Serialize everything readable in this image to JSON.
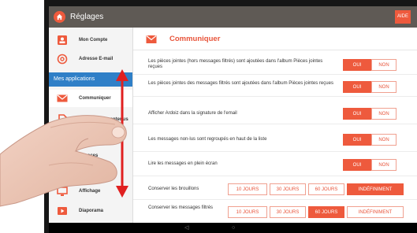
{
  "topbar": {
    "title": "Réglages",
    "aide_label": "AIDE"
  },
  "sidebar": {
    "items_top": [
      {
        "label": "Mon Compte",
        "icon": "account-icon"
      },
      {
        "label": "Adresse E-mail",
        "icon": "at-sign-icon"
      }
    ],
    "section_label": "Mes applications",
    "items_apps": [
      {
        "label": "Communiquer",
        "icon": "envelope-icon"
      },
      {
        "label": "Gestion des contenus",
        "icon": "document-icon"
      },
      {
        "label": "Espaces",
        "icon": "spaces-icon"
      },
      {
        "label": "Affichage",
        "icon": "display-icon"
      },
      {
        "label": "Diaporama",
        "icon": "slideshow-icon"
      }
    ]
  },
  "main": {
    "title": "Communiquer",
    "rows": [
      {
        "label": "Les pièces jointes (hors messages filtrés) sont ajoutées dans l'album Pièces jointes reçues",
        "on": "OUI",
        "off": "NON"
      },
      {
        "label": "Les pièces jointes des messages filtrés sont ajoutées dans l'album Pièces jointes reçues",
        "on": "OUI",
        "off": "NON"
      },
      {
        "label": "Afficher Ardoiz dans la signature de l'email",
        "on": "OUI",
        "off": "NON"
      },
      {
        "label": "Les messages non-lus sont regroupés en haut de la liste",
        "on": "OUI",
        "off": "NON"
      },
      {
        "label": "Lire les messages en plein écran",
        "on": "OUI",
        "off": "NON"
      }
    ],
    "keep_drafts": {
      "label": "Conserver les brouillons",
      "options": [
        "10 JOURS",
        "30 JOURS",
        "60 JOURS",
        "INDÉFINIMENT"
      ],
      "selected": "INDÉFINIMENT"
    },
    "keep_filtered": {
      "label": "Conserver les messages filtrés",
      "options": [
        "10 JOURS",
        "30 JOURS",
        "60 JOURS",
        "INDÉFINIMENT"
      ],
      "selected": "60 JOURS"
    }
  },
  "colors": {
    "accent": "#ee5a3d",
    "section_blue": "#2f7fc7",
    "topbar": "#5f5a55",
    "arrow": "#e02020"
  }
}
